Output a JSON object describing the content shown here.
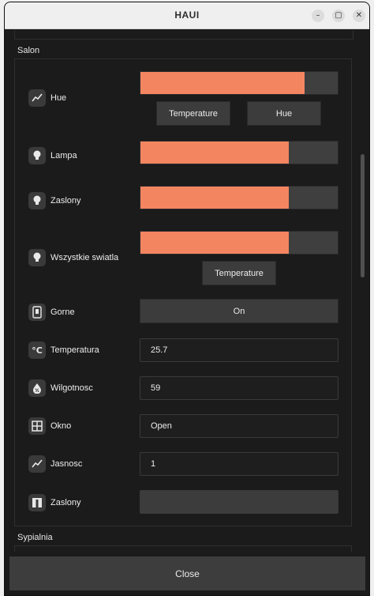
{
  "window": {
    "title": "HAUI"
  },
  "sections": {
    "salon": {
      "title": "Salon"
    },
    "sypialnia": {
      "title": "Sypialnia"
    }
  },
  "rows": {
    "hue": {
      "label": "Hue",
      "icon": "chart-line-icon",
      "level": 0.83,
      "buttons": [
        "Temperature",
        "Hue"
      ]
    },
    "lampa": {
      "label": "Lampa",
      "icon": "lightbulb-icon",
      "level": 0.75
    },
    "zaslony1": {
      "label": "Zaslony",
      "icon": "lightbulb-icon",
      "level": 0.75
    },
    "wszystkie": {
      "label": "Wszystkie swiatla",
      "icon": "lightbulb-icon",
      "level": 0.75,
      "buttons": [
        "Temperature"
      ]
    },
    "gorne": {
      "label": "Gorne",
      "icon": "switch-icon",
      "button": "On"
    },
    "temperatura": {
      "label": "Temperatura",
      "icon": "thermometer-celsius-icon",
      "value": "25.7"
    },
    "wilgotnosc": {
      "label": "Wilgotnosc",
      "icon": "water-percent-icon",
      "value": "59"
    },
    "okno": {
      "label": "Okno",
      "icon": "window-icon",
      "value": "Open"
    },
    "jasnosc": {
      "label": "Jasnosc",
      "icon": "chart-line-icon",
      "value": "1"
    },
    "zaslony2": {
      "label": "Zaslony",
      "icon": "curtains-icon",
      "value": ""
    }
  },
  "footer": {
    "close_label": "Close"
  },
  "colors": {
    "accent": "#f48561",
    "background": "#1b1b1b",
    "button": "#3c3c3c"
  }
}
